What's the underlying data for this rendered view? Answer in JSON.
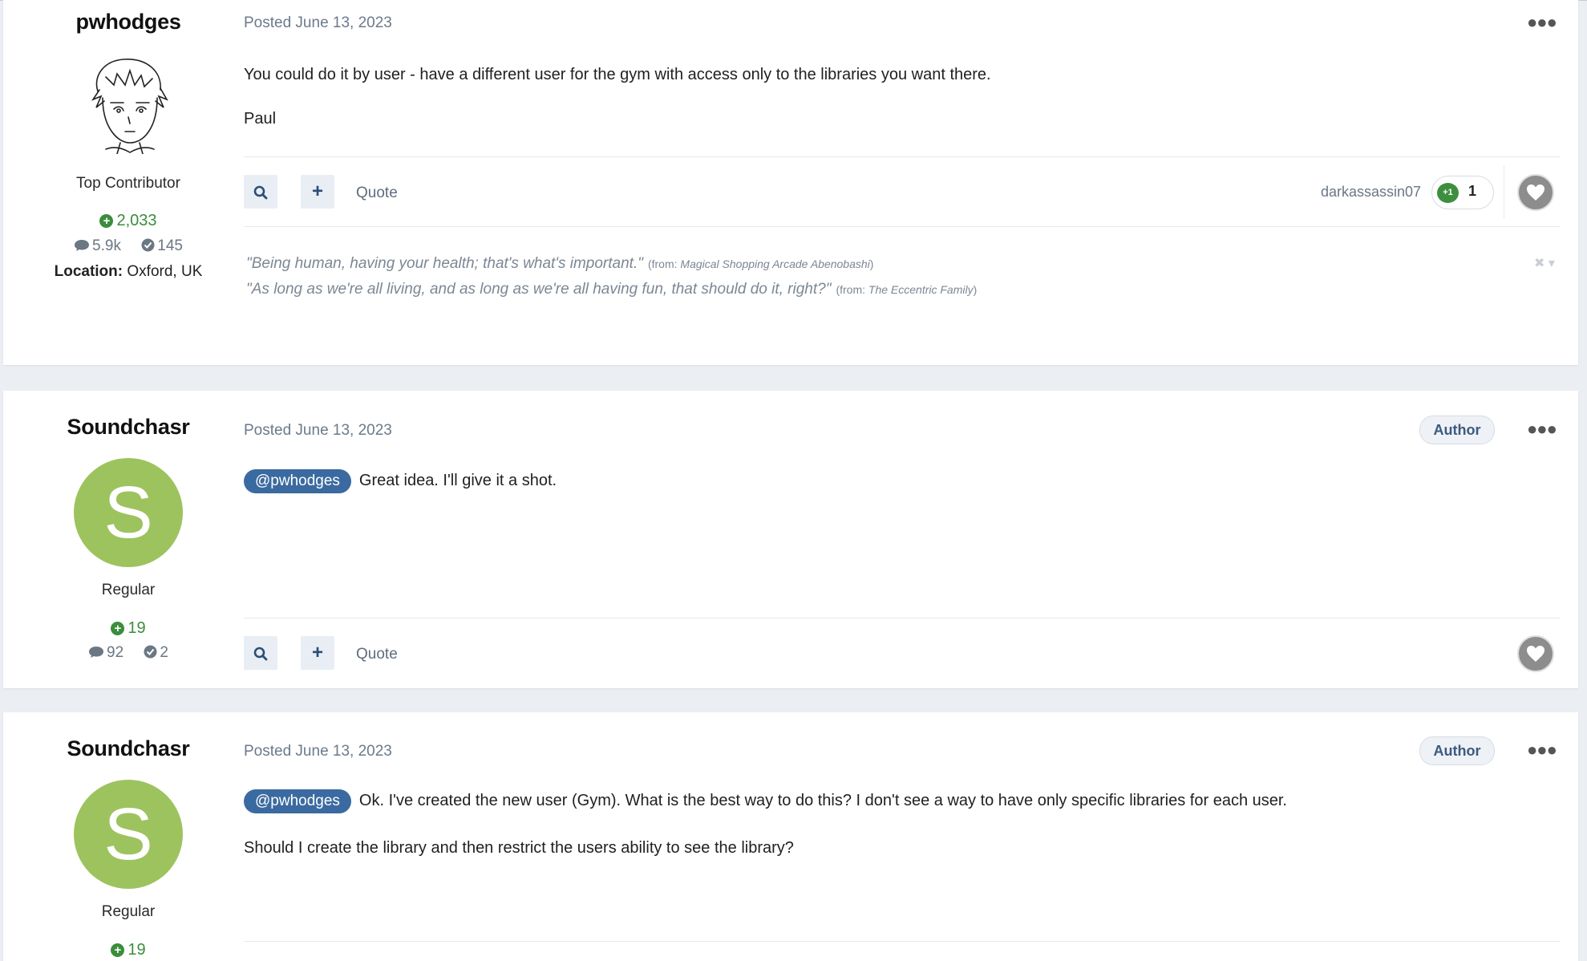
{
  "posts": [
    {
      "username": "pwhodges",
      "rank": "Top Contributor",
      "reputation": "2,033",
      "posts_count": "5.9k",
      "solutions_count": "145",
      "location_label": "Location:",
      "location_value": "Oxford, UK",
      "posted": "Posted June 13, 2023",
      "body": [
        "You could do it by user - have a different user for the gym with access only to the libraries you want there.",
        "Paul"
      ],
      "quote_label": "Quote",
      "reactor": "darkassassin07",
      "reaction_badge": "+1",
      "reaction_count": "1",
      "signature": [
        {
          "text": "\"Being human, having your health; that's what's important.\"",
          "from_prefix": "(from: ",
          "from_title": "Magical Shopping Arcade Abenobashi",
          "from_suffix": ")"
        },
        {
          "text": "\"As long as we're all living, and as long as we're all having fun, that should do it, right?\"",
          "from_prefix": "(from: ",
          "from_title": "The Eccentric Family",
          "from_suffix": ")"
        }
      ]
    },
    {
      "username": "Soundchasr",
      "avatar_letter": "S",
      "rank": "Regular",
      "reputation": "19",
      "posts_count": "92",
      "solutions_count": "2",
      "posted": "Posted June 13, 2023",
      "author_badge": "Author",
      "mention": "@pwhodges",
      "body": [
        "Great idea.  I'll give it a shot."
      ],
      "quote_label": "Quote"
    },
    {
      "username": "Soundchasr",
      "avatar_letter": "S",
      "rank": "Regular",
      "reputation": "19",
      "posted": "Posted June 13, 2023",
      "author_badge": "Author",
      "mention": "@pwhodges",
      "body": [
        "Ok. I've created the new user (Gym).  What is the best way to do this?  I don't see a way to have only specific libraries for each user.",
        "Should I create the library and then restrict the users ability to see the library?"
      ]
    }
  ],
  "colors": {
    "page_bg": "#ebeef2",
    "avatar_green": "#9dc35e",
    "reputation_green": "#3b8d3b",
    "mention_blue": "#3a6aa0"
  },
  "icons": [
    "search-icon",
    "plus-icon",
    "heart-icon",
    "more-icon",
    "comment-icon",
    "check-circle-icon",
    "close-icon",
    "caret-down-icon"
  ]
}
